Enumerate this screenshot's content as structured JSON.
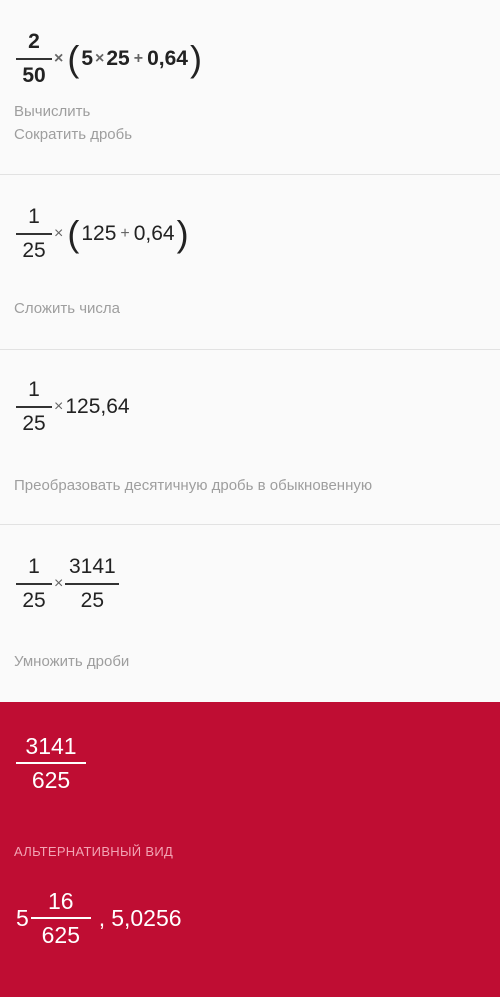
{
  "steps": [
    {
      "frac": {
        "num": "2",
        "den": "50"
      },
      "times": "×",
      "open": "(",
      "a": "5",
      "times2": "×",
      "b": "25",
      "plus": "+",
      "c": "0,64",
      "close": ")",
      "captions": [
        "Вычислить",
        "Сократить дробь"
      ]
    },
    {
      "frac": {
        "num": "1",
        "den": "25"
      },
      "times": "×",
      "open": "(",
      "a": "125",
      "plus": "+",
      "c": "0,64",
      "close": ")",
      "captions": [
        "Сложить числа"
      ]
    },
    {
      "frac": {
        "num": "1",
        "den": "25"
      },
      "times": "×",
      "value": "125,64",
      "captions": [
        "Преобразовать десятичную дробь в обыкновенную"
      ]
    },
    {
      "frac": {
        "num": "1",
        "den": "25"
      },
      "times": "×",
      "frac2": {
        "num": "3141",
        "den": "25"
      },
      "captions": [
        "Умножить дроби"
      ]
    }
  ],
  "result": {
    "frac": {
      "num": "3141",
      "den": "625"
    },
    "alt_label": "АЛЬТЕРНАТИВНЫЙ ВИД",
    "mixed": {
      "whole": "5",
      "num": "16",
      "den": "625"
    },
    "separator": ",",
    "decimal": "5,0256",
    "background": "#bf0d33"
  }
}
